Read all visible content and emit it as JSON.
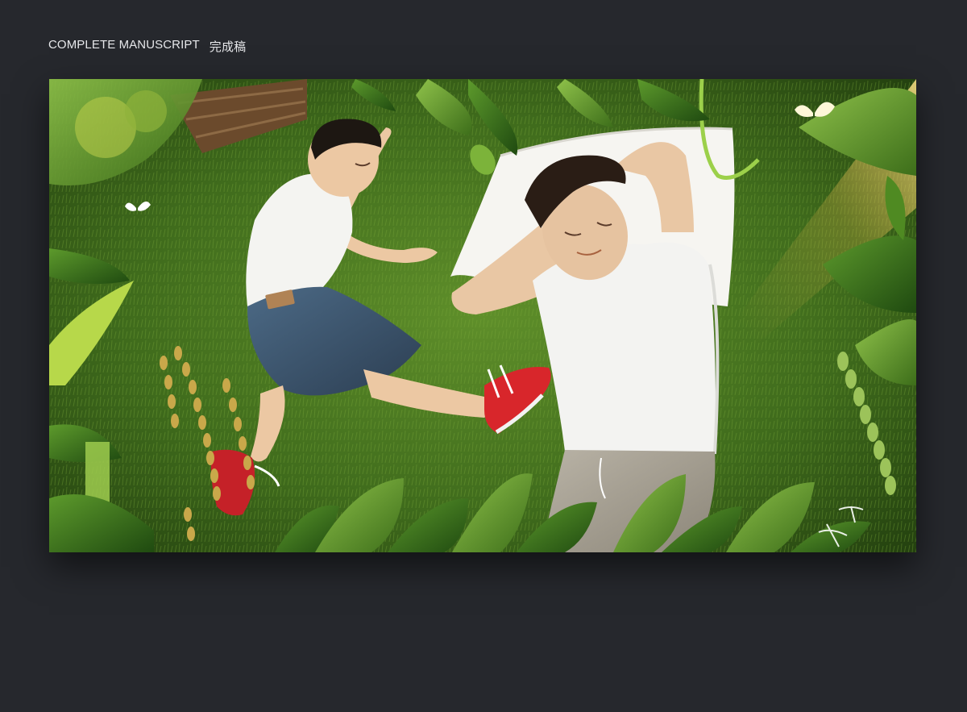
{
  "heading": {
    "title_en": "COMPLETE MANUSCRIPT",
    "title_zh": "完成稿"
  },
  "artwork": {
    "scene": "lawn-with-sleeping-father-and-son",
    "colors": {
      "page_bg": "#26282d",
      "grass": "#4c7a22",
      "shirt": "#f3f3f1",
      "shoe": "#d8262b"
    }
  }
}
